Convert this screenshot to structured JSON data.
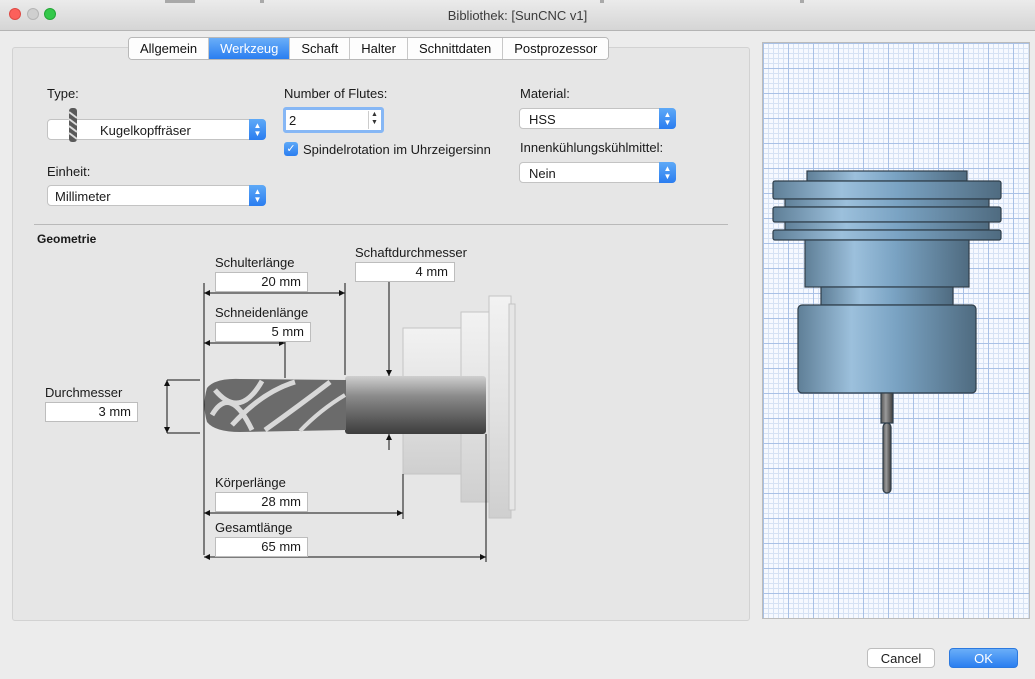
{
  "window": {
    "title": "Bibliothek: [SunCNC v1]"
  },
  "tabs": [
    {
      "label": "Allgemein",
      "active": false
    },
    {
      "label": "Werkzeug",
      "active": true
    },
    {
      "label": "Schaft",
      "active": false
    },
    {
      "label": "Halter",
      "active": false
    },
    {
      "label": "Schnittdaten",
      "active": false
    },
    {
      "label": "Postprozessor",
      "active": false
    }
  ],
  "tool": {
    "type_label": "Type:",
    "type_value": "Kugelkopffräser",
    "unit_label": "Einheit:",
    "unit_value": "Millimeter",
    "flutes_label": "Number of Flutes:",
    "flutes_value": "2",
    "spindle_label": "Spindelrotation im Uhrzeigersinn",
    "spindle_checked": true,
    "material_label": "Material:",
    "material_value": "HSS",
    "coolant_label": "Innenkühlungskühlmittel:",
    "coolant_value": "Nein"
  },
  "geometry": {
    "title": "Geometrie",
    "schulterlaenge_label": "Schulterlänge",
    "schulterlaenge_value": "20 mm",
    "schneidenlaenge_label": "Schneidenlänge",
    "schneidenlaenge_value": "5 mm",
    "schaftdurchmesser_label": "Schaftdurchmesser",
    "schaftdurchmesser_value": "4 mm",
    "durchmesser_label": "Durchmesser",
    "durchmesser_value": "3 mm",
    "koerperlaenge_label": "Körperlänge",
    "koerperlaenge_value": "28 mm",
    "gesamtlaenge_label": "Gesamtlänge",
    "gesamtlaenge_value": "65 mm"
  },
  "buttons": {
    "cancel": "Cancel",
    "ok": "OK"
  },
  "icons": {
    "select_arrows": "updown-chevron-icon",
    "checkbox": "checkmark-icon"
  },
  "colors": {
    "accent": "#2a7ef0",
    "tool_body": "#7fa9c9"
  }
}
